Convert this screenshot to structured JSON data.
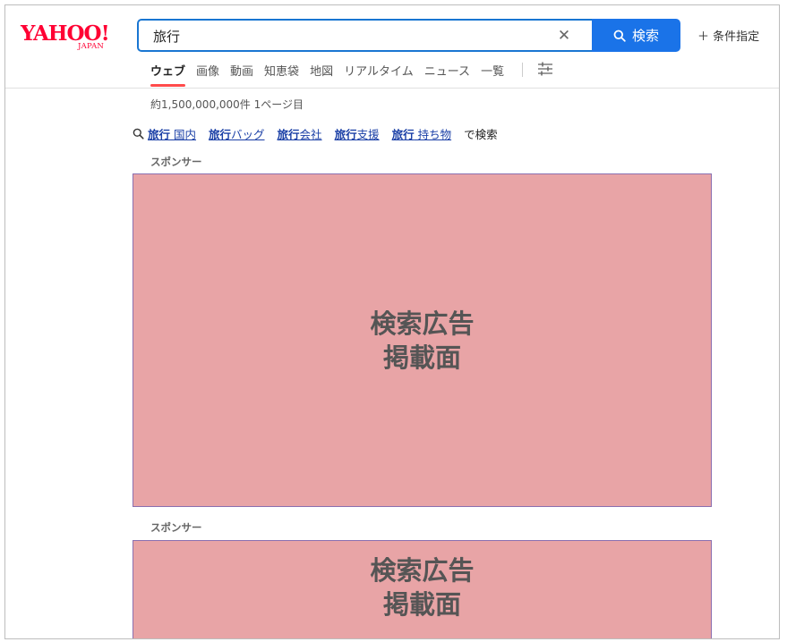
{
  "logo": {
    "main": "YAHOO!",
    "sub": "JAPAN"
  },
  "search": {
    "query": "旅行",
    "button_label": "検索"
  },
  "conditions_label": "＋ 条件指定",
  "tabs": [
    {
      "label": "ウェブ",
      "active": true
    },
    {
      "label": "画像"
    },
    {
      "label": "動画"
    },
    {
      "label": "知恵袋"
    },
    {
      "label": "地図"
    },
    {
      "label": "リアルタイム"
    },
    {
      "label": "ニュース"
    },
    {
      "label": "一覧"
    }
  ],
  "results": {
    "count_text": "約1,500,000,000件 1ページ目"
  },
  "related": {
    "items": [
      {
        "bold": "旅行",
        "rest": " 国内"
      },
      {
        "bold": "旅行",
        "rest": "バッグ"
      },
      {
        "bold": "旅行",
        "rest": "会社"
      },
      {
        "bold": "旅行",
        "rest": "支援"
      },
      {
        "bold": "旅行",
        "rest": " 持ち物"
      }
    ],
    "suffix": "で検索"
  },
  "ads": [
    {
      "sponsor_label": "スポンサー",
      "line1": "検索広告",
      "line2": "掲載面"
    },
    {
      "sponsor_label": "スポンサー",
      "line1": "検索広告",
      "line2": "掲載面"
    }
  ],
  "colors": {
    "accent": "#1a73e8",
    "logo_red": "#ff0033",
    "ad_fill": "#e8a4a6",
    "active_tab_underline": "#ff4b4b"
  }
}
